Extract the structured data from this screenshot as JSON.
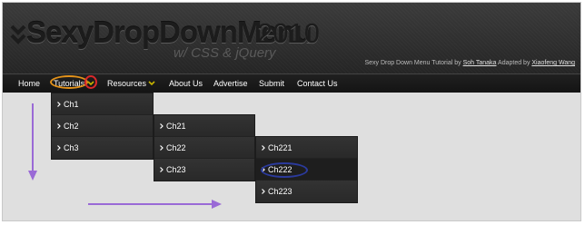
{
  "header": {
    "title": "SexyDropDownMenu",
    "year": "2010",
    "subtitle": "w/ CSS & jQuery",
    "credits": {
      "prefix": "Sexy Drop Down Menu Tutorial by ",
      "author": "Soh Tanaka",
      "middle": " Adapted by ",
      "adapter": "Xiaofeng Wang"
    }
  },
  "nav": {
    "items": [
      {
        "label": "Home"
      },
      {
        "label": "Tutorials",
        "has_dropdown": true
      },
      {
        "label": "Resources",
        "has_dropdown": true
      },
      {
        "label": "About Us"
      },
      {
        "label": "Advertise"
      },
      {
        "label": "Submit"
      },
      {
        "label": "Contact Us"
      }
    ]
  },
  "menus": {
    "level1": [
      "Ch1",
      "Ch2",
      "Ch3"
    ],
    "level2": [
      "Ch21",
      "Ch22",
      "Ch23"
    ],
    "level3": [
      "Ch221",
      "Ch222",
      "Ch223"
    ],
    "highlighted": "Ch222"
  },
  "colors": {
    "nav_bg": "#1a1a1a",
    "menu_bg": "#2b2b2b",
    "chevron_yellow": "#c8b400",
    "annotation_arrow": "#9a6ad6",
    "annotation_orange": "#e3921a",
    "annotation_red": "#d8282a",
    "annotation_blue": "#2b3a9c"
  }
}
